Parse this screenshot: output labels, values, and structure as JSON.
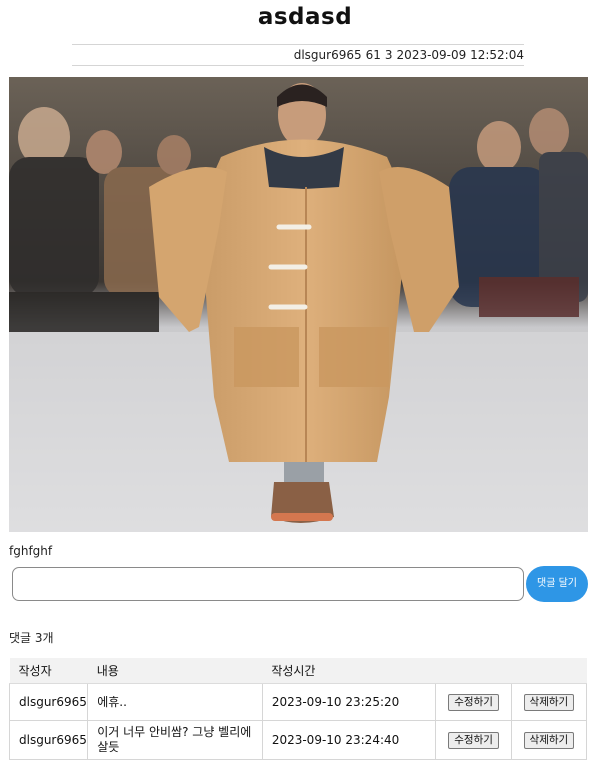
{
  "post": {
    "title": "asdasd",
    "author": "dlsgur6965",
    "views": "61",
    "likes": "3",
    "date": "2023-09-09 12:52:04",
    "body": "fghfghf"
  },
  "comment_form": {
    "button_label": "댓글 달기",
    "value": ""
  },
  "comments": {
    "count_label": "댓글 3개",
    "headers": [
      "작성자",
      "내용",
      "작성시간"
    ],
    "rows": [
      {
        "author": "dlsgur6965",
        "content": "에휴..",
        "time": "2023-09-10 23:25:20",
        "edit_label": "수정하기",
        "delete_label": "삭제하기"
      },
      {
        "author": "dlsgur6965",
        "content": "이거 너무 안비쌈? 그냥 벨리에 살듯",
        "time": "2023-09-10 23:24:40",
        "edit_label": "수정하기",
        "delete_label": "삭제하기"
      }
    ]
  },
  "colors": {
    "accent": "#2e96e6",
    "coat": "#d9ab77"
  }
}
